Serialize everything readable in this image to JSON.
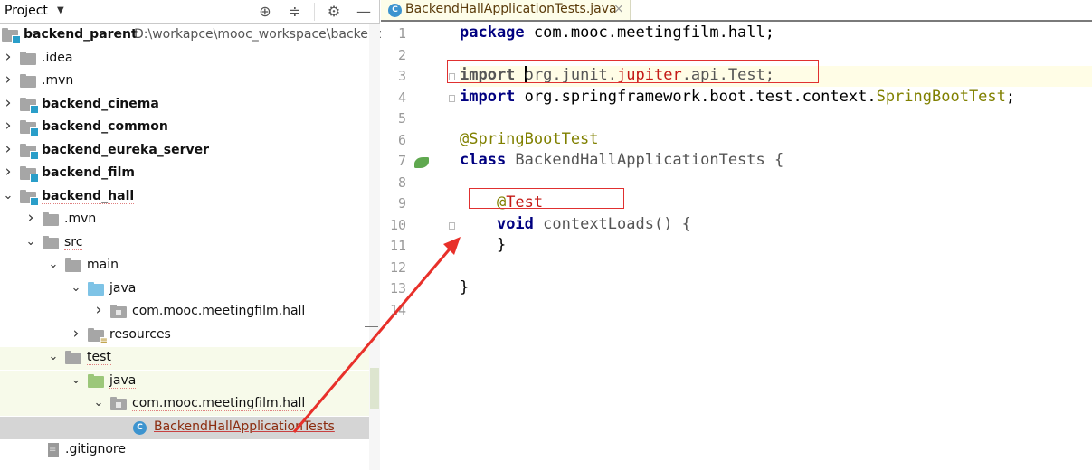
{
  "project_panel": {
    "title": "Project",
    "icons": [
      "locate-icon",
      "collapse-all-icon",
      "gear-icon",
      "minimize-icon"
    ],
    "tree": [
      {
        "label": "backend_parent",
        "extra": "D:\\workapce\\mooc_workspace\\backend_",
        "depth": 0,
        "icon": "module-folder",
        "bold": true,
        "expanded": true
      },
      {
        "label": ".idea",
        "depth": 1,
        "icon": "folder",
        "expanded": false
      },
      {
        "label": ".mvn",
        "depth": 1,
        "icon": "folder",
        "expanded": false
      },
      {
        "label": "backend_cinema",
        "depth": 1,
        "icon": "module-folder",
        "bold": true,
        "expanded": false
      },
      {
        "label": "backend_common",
        "depth": 1,
        "icon": "module-folder",
        "bold": true,
        "expanded": false
      },
      {
        "label": "backend_eureka_server",
        "depth": 1,
        "icon": "module-folder",
        "bold": true,
        "expanded": false
      },
      {
        "label": "backend_film",
        "depth": 1,
        "icon": "module-folder",
        "bold": true,
        "expanded": false
      },
      {
        "label": "backend_hall",
        "depth": 1,
        "icon": "module-folder",
        "bold": true,
        "expanded": true
      },
      {
        "label": ".mvn",
        "depth": 2,
        "icon": "folder",
        "expanded": false
      },
      {
        "label": "src",
        "depth": 2,
        "icon": "folder",
        "expanded": true
      },
      {
        "label": "main",
        "depth": 3,
        "icon": "folder",
        "expanded": true
      },
      {
        "label": "java",
        "depth": 4,
        "icon": "source-folder",
        "expanded": true
      },
      {
        "label": "com.mooc.meetingfilm.hall",
        "depth": 5,
        "icon": "package",
        "expanded": false
      },
      {
        "label": "resources",
        "depth": 4,
        "icon": "resources-folder",
        "expanded": false
      },
      {
        "label": "test",
        "depth": 3,
        "icon": "folder",
        "expanded": true
      },
      {
        "label": "java",
        "depth": 4,
        "icon": "test-folder",
        "expanded": true
      },
      {
        "label": "com.mooc.meetingfilm.hall",
        "depth": 5,
        "icon": "package",
        "expanded": true
      },
      {
        "label": "BackendHallApplicationTests",
        "depth": 6,
        "icon": "class",
        "selected": true
      },
      {
        "label": ".gitignore",
        "depth": 2,
        "icon": "text-file"
      }
    ]
  },
  "editor": {
    "tab": {
      "label": "BackendHallApplicationTests.java",
      "close": "×",
      "icon_letter": "C"
    },
    "line_numbers": [
      "1",
      "2",
      "3",
      "4",
      "5",
      "6",
      "7",
      "8",
      "9",
      "10",
      "11",
      "12",
      "13",
      "14"
    ],
    "lines": [
      [
        {
          "t": "package",
          "c": "kw"
        },
        {
          "t": " com.mooc.meetingfilm.hall;",
          "c": ""
        }
      ],
      [],
      [
        {
          "t": "import",
          "c": "kw muted"
        },
        {
          "t": " ",
          "c": ""
        },
        {
          "t": "|",
          "c": "caret"
        },
        {
          "t": "org.junit.",
          "c": "muted"
        },
        {
          "t": "jupiter",
          "c": "err-red"
        },
        {
          "t": ".api.Test;",
          "c": "muted"
        }
      ],
      [
        {
          "t": "import",
          "c": "kw"
        },
        {
          "t": " org.springframework.boot.test.context.",
          "c": ""
        },
        {
          "t": "SpringBootTest",
          "c": "ann"
        },
        {
          "t": ";",
          "c": ""
        }
      ],
      [],
      [
        {
          "t": "@SpringBootTest",
          "c": "ann"
        }
      ],
      [
        {
          "t": "class",
          "c": "kw"
        },
        {
          "t": " BackendHallApplicationTests {",
          "c": "muted"
        }
      ],
      [],
      [
        {
          "t": "    @",
          "c": "ann"
        },
        {
          "t": "Test",
          "c": "err-red"
        }
      ],
      [
        {
          "t": "    ",
          "c": ""
        },
        {
          "t": "void",
          "c": "kw"
        },
        {
          "t": " contextLoads() {",
          "c": "muted"
        }
      ],
      [
        {
          "t": "    }",
          "c": ""
        }
      ],
      [],
      [
        {
          "t": "}",
          "c": ""
        }
      ],
      []
    ],
    "current_line": 3
  },
  "annotations": {
    "color": "#e8302a"
  }
}
